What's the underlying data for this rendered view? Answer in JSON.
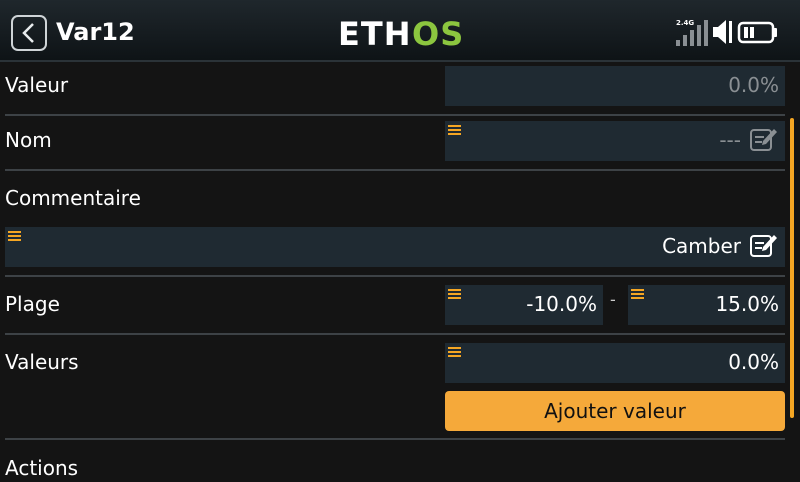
{
  "header": {
    "title": "Var12",
    "logo_left": "ETH",
    "logo_right": "OS",
    "signal_band": "2.4G"
  },
  "rows": {
    "valeur": {
      "label": "Valeur",
      "value": "0.0%"
    },
    "nom": {
      "label": "Nom",
      "value": "---"
    },
    "commentaire": {
      "label": "Commentaire",
      "value": "Camber"
    },
    "plage": {
      "label": "Plage",
      "min": "-10.0%",
      "separator": "-",
      "max": "15.0%"
    },
    "valeurs": {
      "label": "Valeurs",
      "value": "0.0%",
      "add_button": "Ajouter valeur"
    },
    "actions": {
      "label": "Actions"
    }
  },
  "colors": {
    "accent": "#f5a623",
    "field_bg": "#1f2a32",
    "background": "#141414",
    "logo_green": "#8cc63f"
  }
}
